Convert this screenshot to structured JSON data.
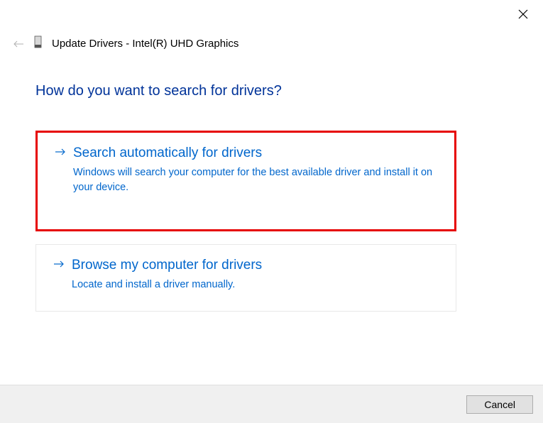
{
  "header": {
    "title": "Update Drivers - Intel(R) UHD Graphics"
  },
  "main": {
    "question": "How do you want to search for drivers?",
    "options": [
      {
        "title": "Search automatically for drivers",
        "description": "Windows will search your computer for the best available driver and install it on your device."
      },
      {
        "title": "Browse my computer for drivers",
        "description": "Locate and install a driver manually."
      }
    ]
  },
  "footer": {
    "cancel_label": "Cancel"
  }
}
